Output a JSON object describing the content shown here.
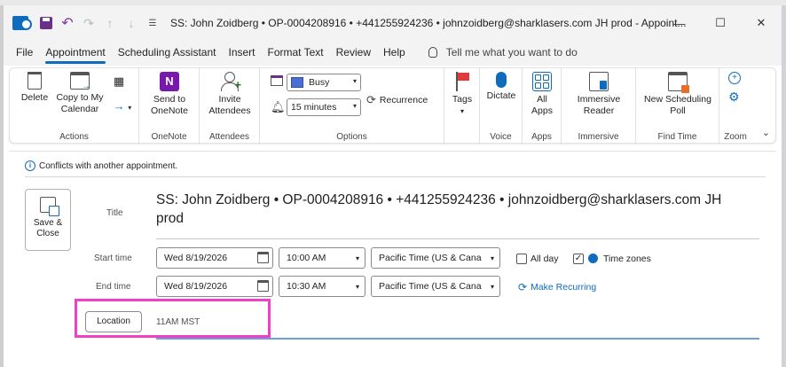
{
  "window": {
    "title": "SS: John Zoidberg  •  OP-0004208916  •  +441255924236  •  johnzoidberg@sharklasers.com JH prod  -  Appoint...",
    "minimize": "—",
    "maximize": "☐",
    "close": "✕"
  },
  "menu": {
    "tabs": [
      "File",
      "Appointment",
      "Scheduling Assistant",
      "Insert",
      "Format Text",
      "Review",
      "Help"
    ],
    "active": "Appointment",
    "tell_me": "Tell me what you want to do"
  },
  "ribbon": {
    "actions": {
      "delete": "Delete",
      "copy_to_calendar": "Copy to My Calendar",
      "label": "Actions"
    },
    "onenote": {
      "send": "Send to OneNote",
      "label": "OneNote"
    },
    "attendees": {
      "invite": "Invite Attendees",
      "label": "Attendees"
    },
    "options": {
      "show_as": "Busy",
      "reminder": "15 minutes",
      "recurrence": "Recurrence",
      "label": "Options"
    },
    "tags": {
      "tags": "Tags"
    },
    "voice": {
      "dictate": "Dictate",
      "label": "Voice"
    },
    "apps": {
      "all_apps": "All Apps",
      "label": "Apps"
    },
    "immersive": {
      "reader": "Immersive Reader",
      "label": "Immersive"
    },
    "find_time": {
      "poll": "New Scheduling Poll",
      "label": "Find Time"
    },
    "zoom": {
      "label": "Zoom"
    }
  },
  "form": {
    "conflict_notice": "Conflicts with another appointment.",
    "save_close": "Save & Close",
    "title_label": "Title",
    "title_value": "SS: John Zoidberg  •  OP-0004208916  •  +441255924236  •  johnzoidberg@sharklasers.com JH prod",
    "start_label": "Start time",
    "start_date": "Wed 8/19/2026",
    "start_time": "10:00 AM",
    "start_tz": "Pacific Time (US & Cana",
    "all_day": "All day",
    "time_zones": "Time zones",
    "end_label": "End time",
    "end_date": "Wed 8/19/2026",
    "end_time": "10:30 AM",
    "end_tz": "Pacific Time (US & Cana",
    "make_recurring": "Make Recurring",
    "location_button": "Location",
    "location_value": "11AM MST"
  },
  "colors": {
    "accent": "#0f6cbd",
    "highlight_box": "#f040c8"
  }
}
